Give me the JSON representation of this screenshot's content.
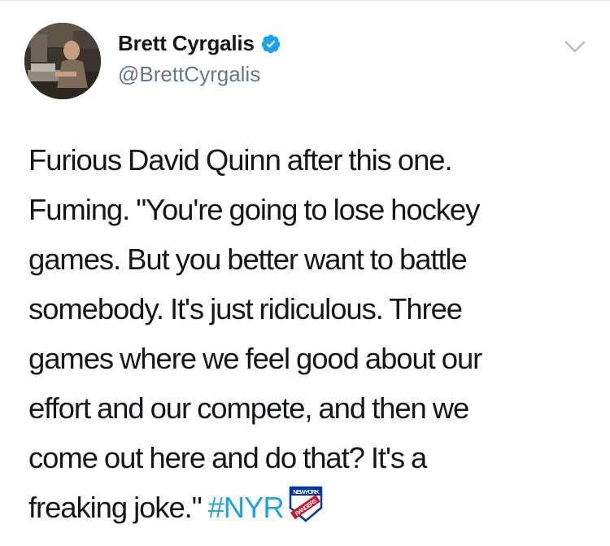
{
  "tweet": {
    "author": {
      "display_name": "Brett Cyrgalis",
      "handle": "@BrettCyrgalis",
      "verified": true,
      "avatar_icon": "profile-photo"
    },
    "menu_icon": "chevron-down-icon",
    "text_lines": [
      "Furious David Quinn after this one.",
      "Fuming. \"You're going to lose hockey",
      "games. But you better want to battle",
      "somebody. It's just ridiculous. Three",
      "games where we feel good about our",
      "effort and our compete, and then we",
      "come out here and do that? It's a",
      "freaking joke.\""
    ],
    "hashtag": "#NYR",
    "hashflag": {
      "icon": "new-york-rangers-logo",
      "text_top": "NEW YORK",
      "text_bottom": "RANGERS"
    }
  },
  "colors": {
    "text": "#14171a",
    "secondary": "#657786",
    "link": "#1da1f2",
    "verified": "#1da1f2",
    "border": "#e1e8ed"
  }
}
